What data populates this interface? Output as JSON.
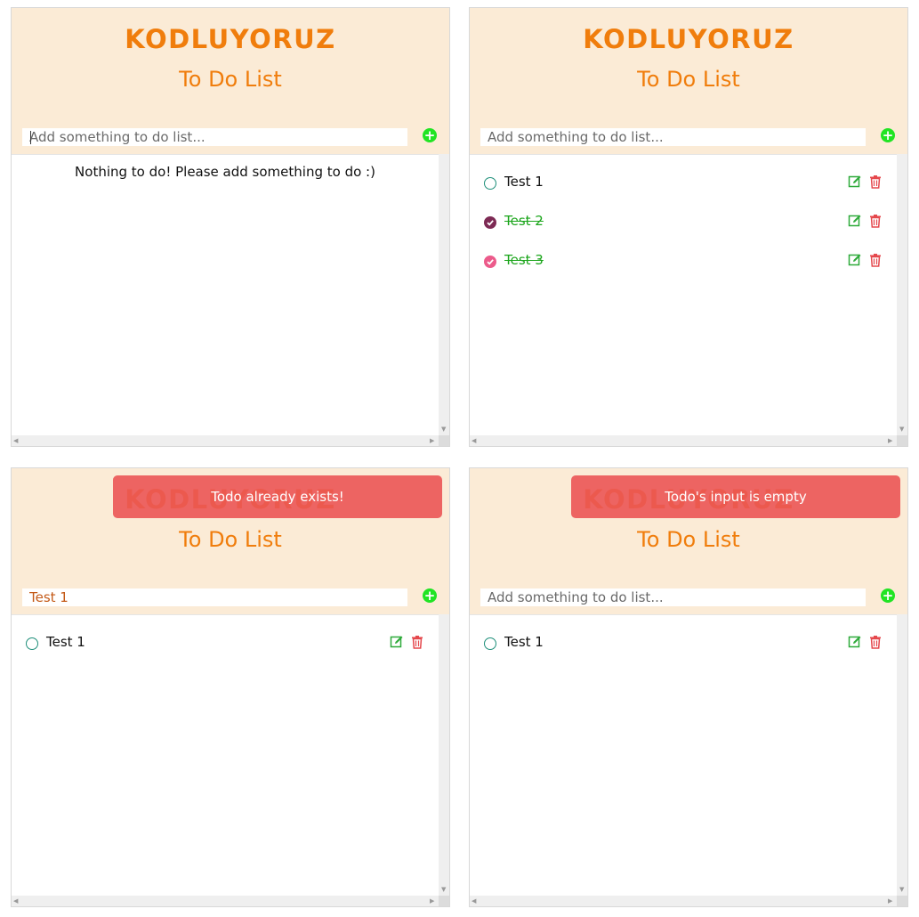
{
  "logo_text": "KODLUYORUZ",
  "app_title": "To Do List",
  "input_placeholder": "Add something to do list...",
  "add_label": "+",
  "panels": [
    {
      "input_value": "",
      "empty_message": "Nothing to do! Please add something to do :)",
      "todos": []
    },
    {
      "input_value": "",
      "todos": [
        {
          "text": "Test 1",
          "done": false
        },
        {
          "text": "Test 2",
          "done": true,
          "check_color": "#7d2a54"
        },
        {
          "text": "Test 3",
          "done": true,
          "check_color": "#ec5b8b"
        }
      ]
    },
    {
      "input_value": "Test 1",
      "toast": "Todo already exists!",
      "todos": [
        {
          "text": "Test 1",
          "done": false
        }
      ]
    },
    {
      "input_value": "",
      "toast": "Todo's input is empty",
      "todos": [
        {
          "text": "Test 1",
          "done": false
        }
      ]
    }
  ],
  "colors": {
    "brand_orange": "#f07d0c",
    "header_bg": "#fbebd6",
    "add_green": "#21e424",
    "done_text": "#1ba51b",
    "toast_red": "#eb5555",
    "edit_green": "#2eaa3a",
    "delete_red": "#e5484d"
  },
  "icons": {
    "add": "plus-circle-icon",
    "edit": "edit-icon",
    "delete": "trash-icon",
    "check": "check-circle-icon"
  }
}
